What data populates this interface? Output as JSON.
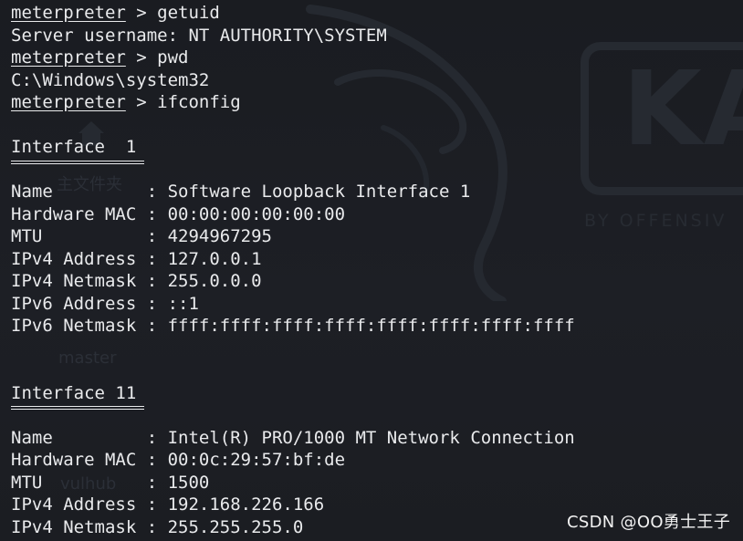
{
  "terminal": {
    "prompt": "meterpreter",
    "cmd_getuid": " > getuid",
    "server_username": "Server username: NT AUTHORITY\\SYSTEM",
    "cmd_pwd": " > pwd",
    "cwd": "C:\\Windows\\system32",
    "cmd_ifconfig": " > ifconfig",
    "interfaces": [
      {
        "header": "Interface  1",
        "rows": [
          "Name         : Software Loopback Interface 1",
          "Hardware MAC : 00:00:00:00:00:00",
          "MTU          : 4294967295",
          "IPv4 Address : 127.0.0.1",
          "IPv4 Netmask : 255.0.0.0",
          "IPv6 Address : ::1",
          "IPv6 Netmask : ffff:ffff:ffff:ffff:ffff:ffff:ffff:ffff"
        ]
      },
      {
        "header": "Interface 11",
        "rows": [
          "Name         : Intel(R) PRO/1000 MT Network Connection",
          "Hardware MAC : 00:0c:29:57:bf:de",
          "MTU          : 1500",
          "IPv4 Address : 192.168.226.166",
          "IPv4 Netmask : 255.255.255.0"
        ]
      }
    ]
  },
  "background": {
    "brand": "KA",
    "brand_sub": "BY OFFENSIV",
    "folders": [
      "主文件夹",
      "master",
      "vulhub"
    ]
  },
  "watermark": "CSDN @OO勇士王子"
}
